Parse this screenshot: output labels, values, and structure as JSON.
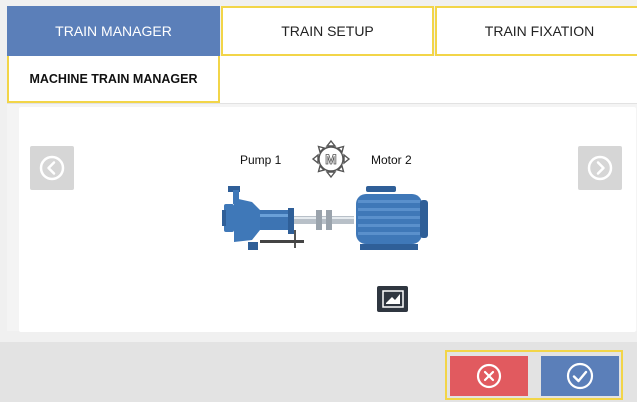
{
  "tabs": [
    {
      "label": "TRAIN MANAGER",
      "active": true
    },
    {
      "label": "TRAIN SETUP",
      "active": false
    },
    {
      "label": "TRAIN FIXATION",
      "active": false
    }
  ],
  "subheader": {
    "label": "MACHINE TRAIN MANAGER"
  },
  "machines": {
    "left": "Pump 1",
    "right": "Motor 2",
    "coupling_icon_letter": "M"
  },
  "icons": {
    "previous": "chevron-left-circle-icon",
    "next": "chevron-right-circle-icon",
    "coupling": "coupling-icon",
    "edit": "edit-icon",
    "cancel": "close-circle-icon",
    "confirm": "check-circle-icon"
  },
  "colors": {
    "accent": "#5b7fb9",
    "highlight": "#f2d548",
    "cancel": "#e15a5f",
    "machine_blue": "#3f78b8"
  }
}
